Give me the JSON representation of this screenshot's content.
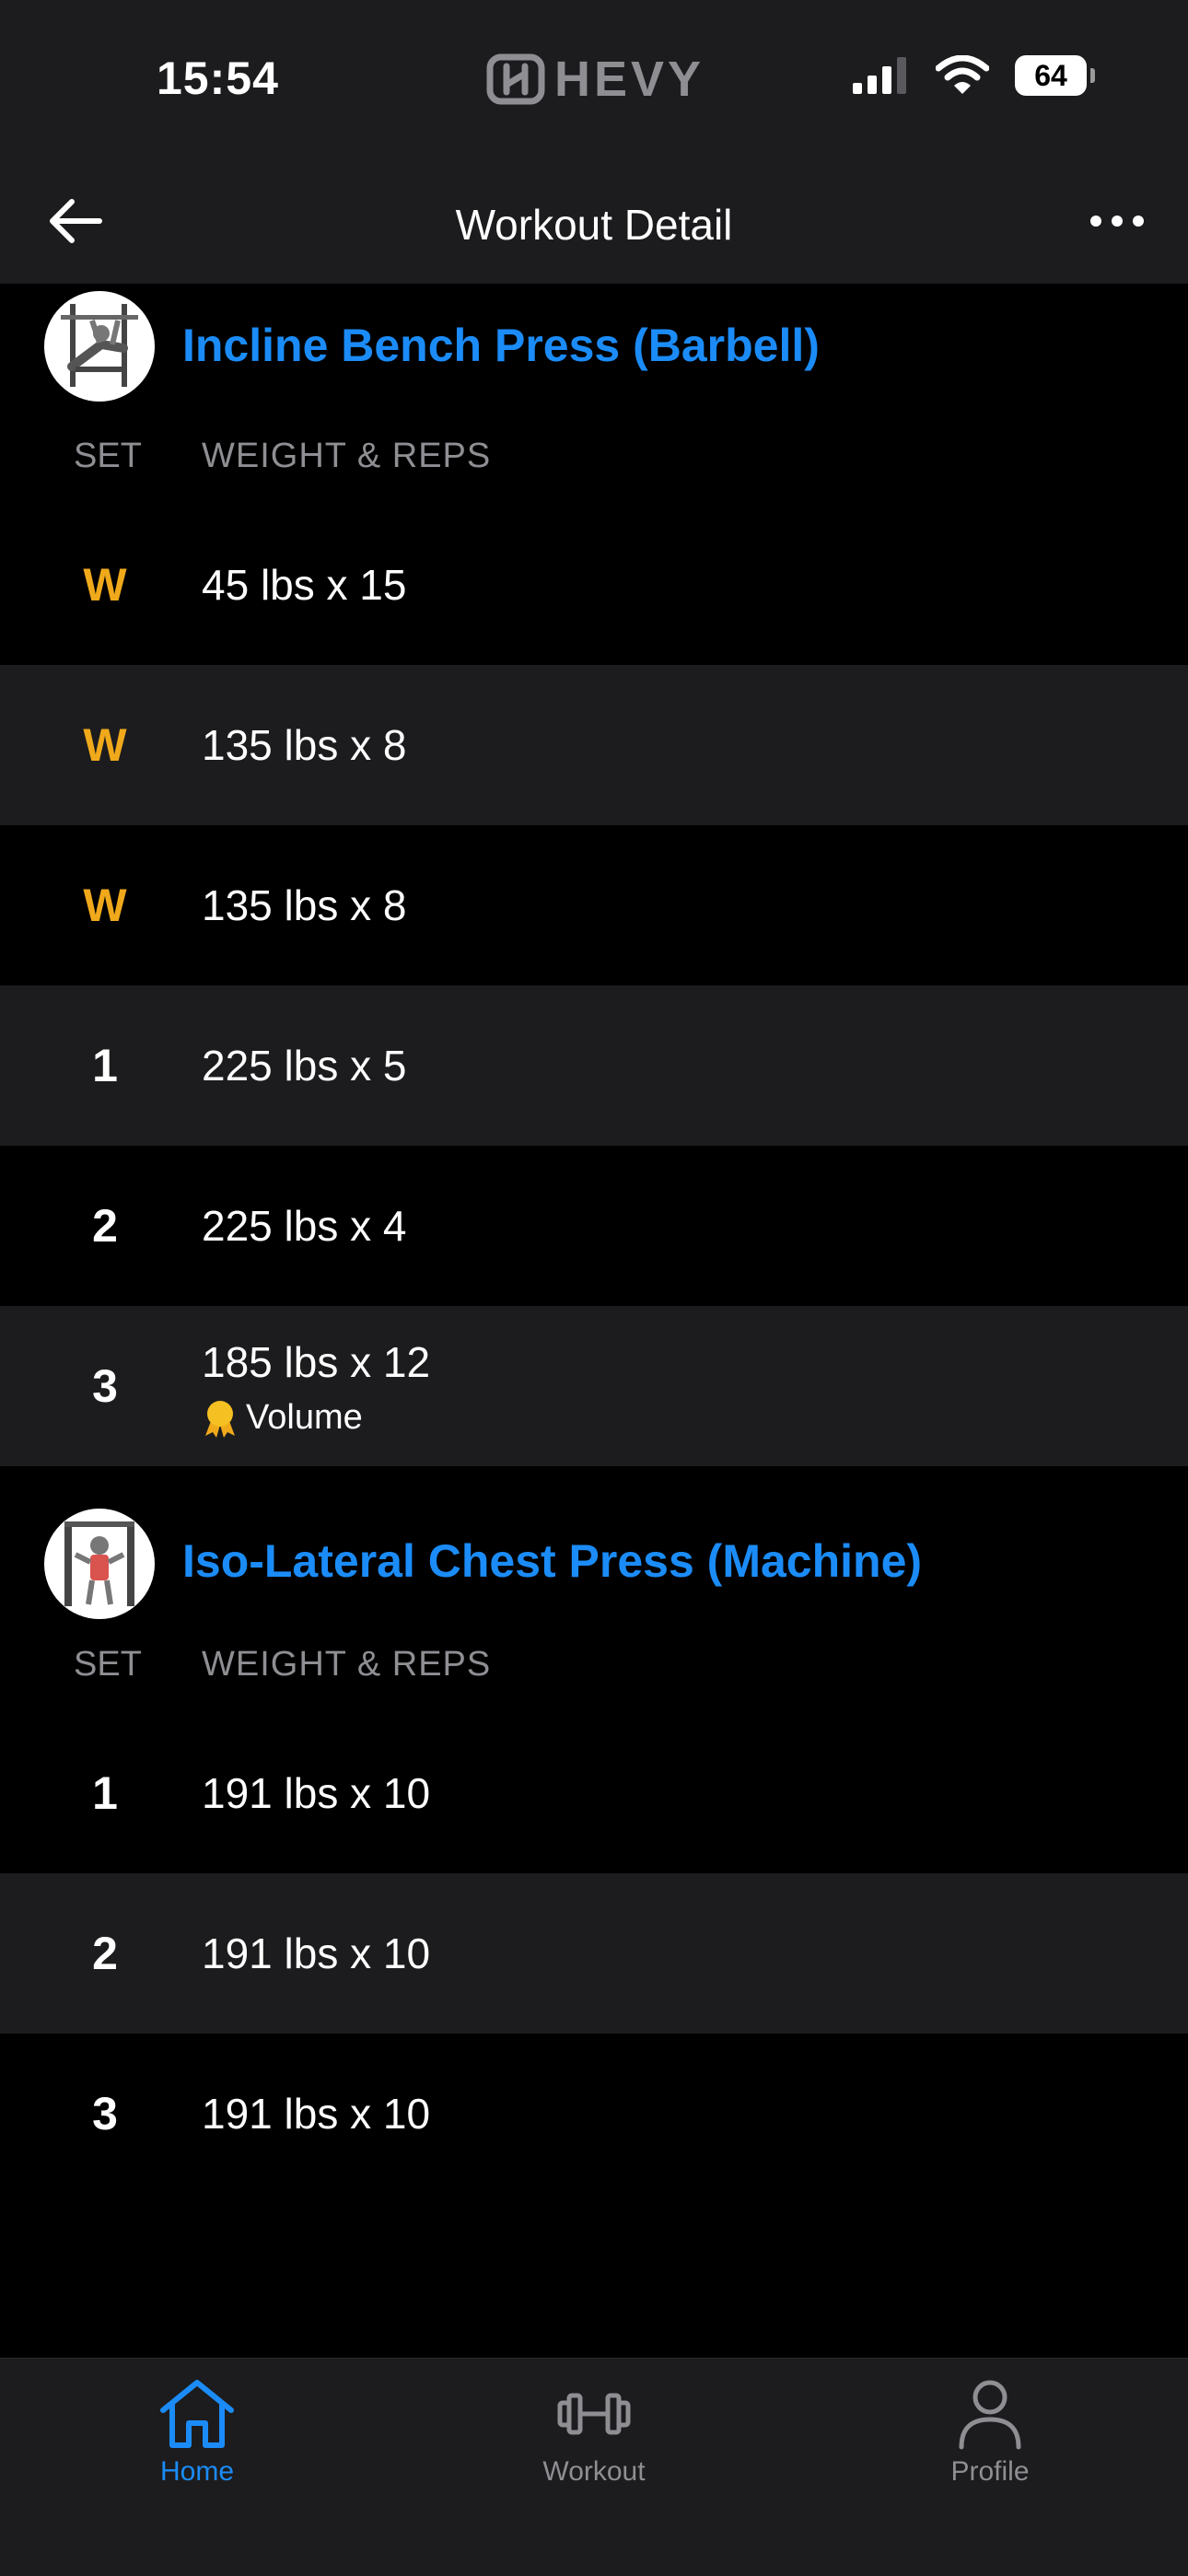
{
  "status_bar": {
    "time": "15:54",
    "brand": "HEVY",
    "battery": "64"
  },
  "nav": {
    "title": "Workout Detail"
  },
  "columns": {
    "set": "SET",
    "weight_reps": "WEIGHT & REPS"
  },
  "exercises": [
    {
      "name": "Incline Bench Press (Barbell)",
      "sets": [
        {
          "label": "W",
          "value": "45 lbs x 15"
        },
        {
          "label": "W",
          "value": "135 lbs x 8"
        },
        {
          "label": "W",
          "value": "135 lbs x 8"
        },
        {
          "label": "1",
          "value": "225 lbs x 5"
        },
        {
          "label": "2",
          "value": "225 lbs x 4"
        },
        {
          "label": "3",
          "value": "185 lbs x 12",
          "record": "Volume"
        }
      ]
    },
    {
      "name": "Iso-Lateral Chest Press (Machine)",
      "sets": [
        {
          "label": "1",
          "value": "191 lbs x 10"
        },
        {
          "label": "2",
          "value": "191 lbs x 10"
        },
        {
          "label": "3",
          "value": "191 lbs x 10"
        }
      ]
    }
  ],
  "tabs": [
    {
      "label": "Home",
      "icon": "home-icon",
      "active": true
    },
    {
      "label": "Workout",
      "icon": "dumbbell-icon",
      "active": false
    },
    {
      "label": "Profile",
      "icon": "person-icon",
      "active": false
    }
  ],
  "colors": {
    "accent": "#1b8cf7",
    "warmup": "#f0a91b",
    "row_alt": "#1c1c1e",
    "background": "#000000"
  }
}
